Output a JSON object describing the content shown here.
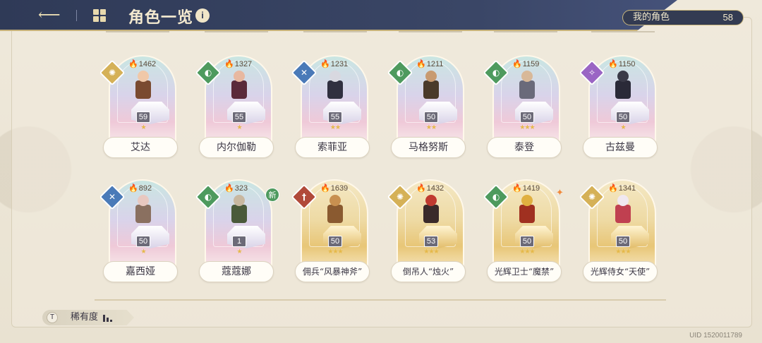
{
  "header": {
    "title": "角色一览",
    "back_icon": "back-arrow-icon",
    "my_characters_label": "我的角色",
    "my_characters_count": "58"
  },
  "colors": {
    "header_bg": "#2f3a57",
    "accent_gold": "#c9b67c",
    "rarity_blue_frame": "#d9d3ea",
    "rarity_gold_frame": "#eedaa4"
  },
  "characters": [
    {
      "name": "艾达",
      "power": "1462",
      "level": "59",
      "stars": "★",
      "class_icon": "gold-sun-icon",
      "frame": "blue"
    },
    {
      "name": "内尔伽勒",
      "power": "1327",
      "level": "55",
      "stars": "★",
      "class_icon": "green-shield-icon",
      "frame": "blue"
    },
    {
      "name": "索菲亚",
      "power": "1231",
      "level": "55",
      "stars": "★★",
      "class_icon": "blue-swords-icon",
      "frame": "blue"
    },
    {
      "name": "马格努斯",
      "power": "1211",
      "level": "50",
      "stars": "★★",
      "class_icon": "green-shield-icon",
      "frame": "blue"
    },
    {
      "name": "泰登",
      "power": "1159",
      "level": "50",
      "stars": "★★★",
      "class_icon": "green-shield-icon",
      "frame": "blue"
    },
    {
      "name": "古兹曼",
      "power": "1150",
      "level": "50",
      "stars": "★",
      "class_icon": "purple-magic-icon",
      "frame": "blue"
    },
    {
      "name": "嘉西娅",
      "power": "892",
      "level": "50",
      "stars": "★",
      "class_icon": "blue-swords-icon",
      "frame": "blue"
    },
    {
      "name": "蔻蔻娜",
      "power": "323",
      "level": "1",
      "stars": "★",
      "class_icon": "green-shield-icon",
      "frame": "blue",
      "new_label": "新"
    },
    {
      "name": "佣兵“风暴神斧”",
      "power": "1639",
      "level": "50",
      "stars": "★★★",
      "class_icon": "red-sword-icon",
      "frame": "gold"
    },
    {
      "name": "倒吊人“烛火”",
      "power": "1432",
      "level": "53",
      "stars": "★★★",
      "class_icon": "gold-sun-icon",
      "frame": "gold"
    },
    {
      "name": "光辉卫士“魔禁”",
      "power": "1419",
      "level": "50",
      "stars": "★★★",
      "class_icon": "green-shield-icon",
      "frame": "gold"
    },
    {
      "name": "光辉侍女“天使”",
      "power": "1341",
      "level": "50",
      "stars": "★★★",
      "class_icon": "gold-sun-icon",
      "frame": "gold"
    }
  ],
  "footer": {
    "sort_icon": "T",
    "sort_label": "稀有度",
    "uid": "UID 1520011789"
  }
}
